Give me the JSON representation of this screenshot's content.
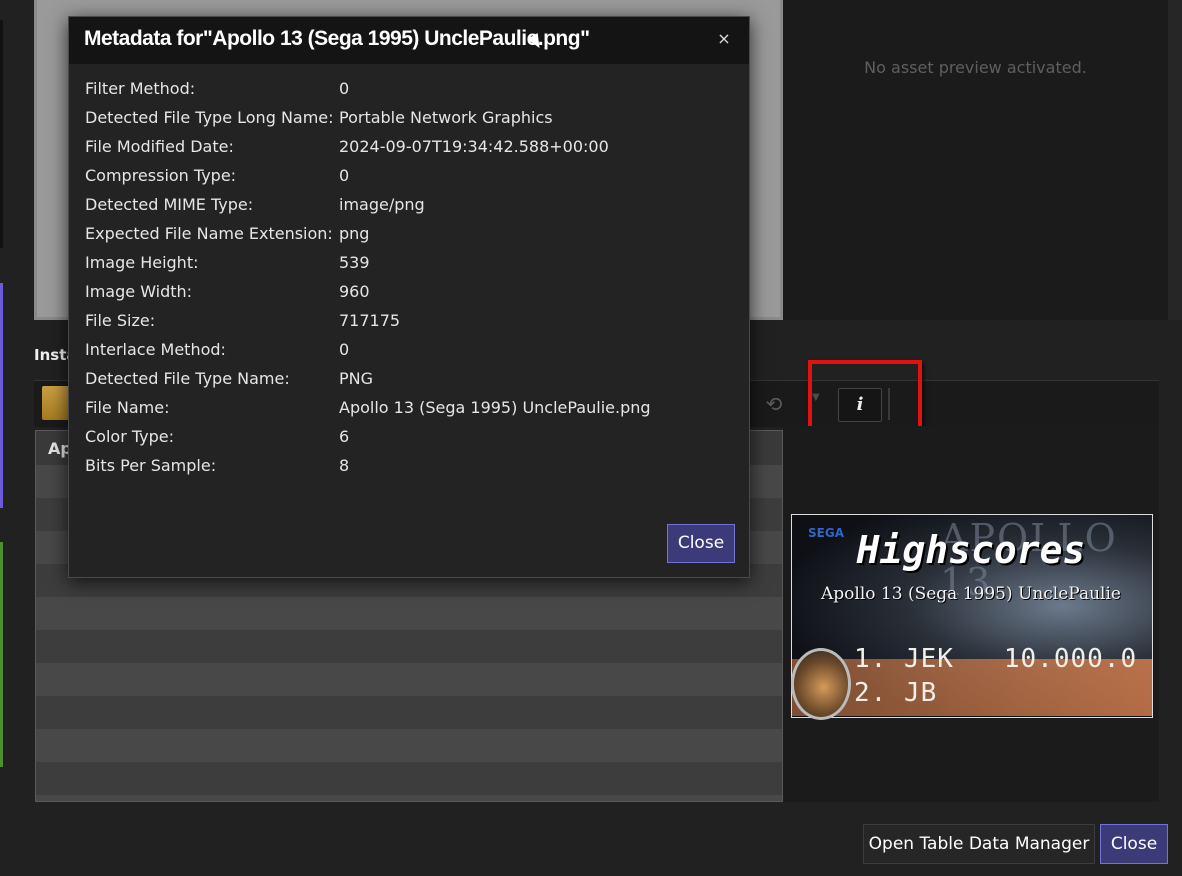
{
  "preview": {
    "no_asset_message": "No asset preview activated."
  },
  "section": {
    "label": "Insta"
  },
  "table_list": {
    "header": "Ap"
  },
  "toolbar": {
    "info_label": "i",
    "sync_icon": "sync-icon",
    "folder_icon": "folder-icon"
  },
  "highscores_image": {
    "sega": "SEGA",
    "watermark": "APOLLO 13",
    "title": "Highscores",
    "subtitle": "Apollo 13 (Sega 1995) UnclePaulie",
    "row1": "1. JEK   10.000.0",
    "row2": "2. JB"
  },
  "buttons": {
    "open_table_data_manager": "Open Table Data Manager",
    "close": "Close"
  },
  "modal": {
    "title": "Metadata for\"Apollo 13 (Sega 1995) UnclePaulie.png\"",
    "close_x": "×",
    "close_label": "Close",
    "rows": [
      {
        "key": "Filter Method:",
        "value": "0"
      },
      {
        "key": "Detected File Type Long Name:",
        "value": "Portable Network Graphics"
      },
      {
        "key": "File Modified Date:",
        "value": "2024-09-07T19:34:42.588+00:00"
      },
      {
        "key": "Compression Type:",
        "value": "0"
      },
      {
        "key": "Detected MIME Type:",
        "value": "image/png"
      },
      {
        "key": "Expected File Name Extension:",
        "value": "png"
      },
      {
        "key": "Image Height:",
        "value": "539"
      },
      {
        "key": "Image Width:",
        "value": "960"
      },
      {
        "key": "File Size:",
        "value": "717175"
      },
      {
        "key": "Interlace Method:",
        "value": "0"
      },
      {
        "key": "Detected File Type Name:",
        "value": "PNG"
      },
      {
        "key": "File Name:",
        "value": "Apollo 13 (Sega 1995) UnclePaulie.png"
      },
      {
        "key": "Color Type:",
        "value": "6"
      },
      {
        "key": "Bits Per Sample:",
        "value": "8"
      }
    ]
  },
  "colors": {
    "accent_button": "#3b3b7a",
    "highlight": "#e11212"
  }
}
